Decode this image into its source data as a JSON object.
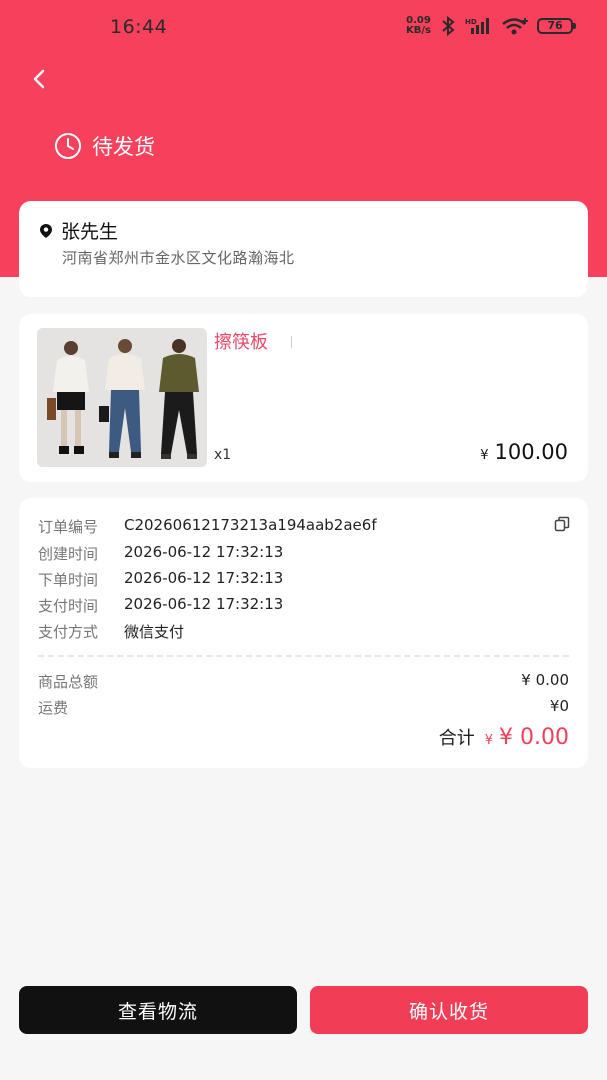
{
  "statusbar": {
    "time": "16:44",
    "net_speed_value": "0.09",
    "net_speed_unit": "KB/s",
    "battery": "76"
  },
  "header": {
    "status_label": "待发货",
    "status_icon": "clock-icon"
  },
  "address": {
    "name": "张先生",
    "detail": "河南省郑州市金水区文化路瀚海北"
  },
  "product": {
    "title": "擦筷板",
    "qty": "x1",
    "price_symbol": "¥",
    "price": "100.00"
  },
  "order": {
    "rows": [
      {
        "label": "订单编号",
        "value": "C20260612173213a194aab2ae6f"
      },
      {
        "label": "创建时间",
        "value": "2026-06-12 17:32:13"
      },
      {
        "label": "下单时间",
        "value": "2026-06-12 17:32:13"
      },
      {
        "label": "支付时间",
        "value": "2026-06-12 17:32:13"
      },
      {
        "label": "支付方式",
        "value": "微信支付"
      }
    ],
    "goods_total_label": "商品总额",
    "goods_total_value": "¥ 0.00",
    "shipping_label": "运费",
    "shipping_value": "¥0",
    "total_label": "合计",
    "total_small_symbol": "¥",
    "total_value": "¥ 0.00"
  },
  "actions": {
    "logistics_label": "查看物流",
    "confirm_label": "确认收货"
  },
  "colors": {
    "accent": "#f7405b",
    "price_red": "#f0405c",
    "dark_button": "#111111"
  }
}
